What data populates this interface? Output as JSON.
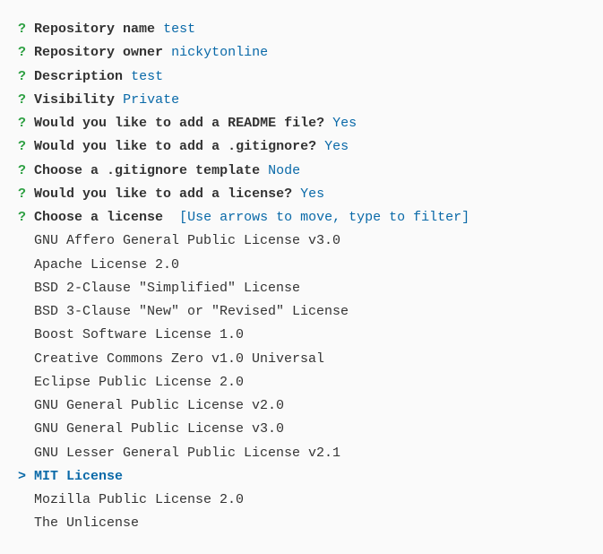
{
  "prompts": [
    {
      "label": "Repository name",
      "answer": "test"
    },
    {
      "label": "Repository owner",
      "answer": "nickytonline"
    },
    {
      "label": "Description",
      "answer": "test"
    },
    {
      "label": "Visibility",
      "answer": "Private"
    },
    {
      "label": "Would you like to add a README file?",
      "answer": "Yes"
    },
    {
      "label": "Would you like to add a .gitignore?",
      "answer": "Yes"
    },
    {
      "label": "Choose a .gitignore template",
      "answer": "Node"
    },
    {
      "label": "Would you like to add a license?",
      "answer": "Yes"
    }
  ],
  "active_prompt": {
    "marker": "?",
    "label": "Choose a license",
    "hint": "[Use arrows to move, type to filter]"
  },
  "options": [
    "GNU Affero General Public License v3.0",
    "Apache License 2.0",
    "BSD 2-Clause \"Simplified\" License",
    "BSD 3-Clause \"New\" or \"Revised\" License",
    "Boost Software License 1.0",
    "Creative Commons Zero v1.0 Universal",
    "Eclipse Public License 2.0",
    "GNU General Public License v2.0",
    "GNU General Public License v3.0",
    "GNU Lesser General Public License v2.1",
    "MIT License",
    "Mozilla Public License 2.0",
    "The Unlicense"
  ],
  "selected_index": 10,
  "marker": "?",
  "cursor": ">"
}
